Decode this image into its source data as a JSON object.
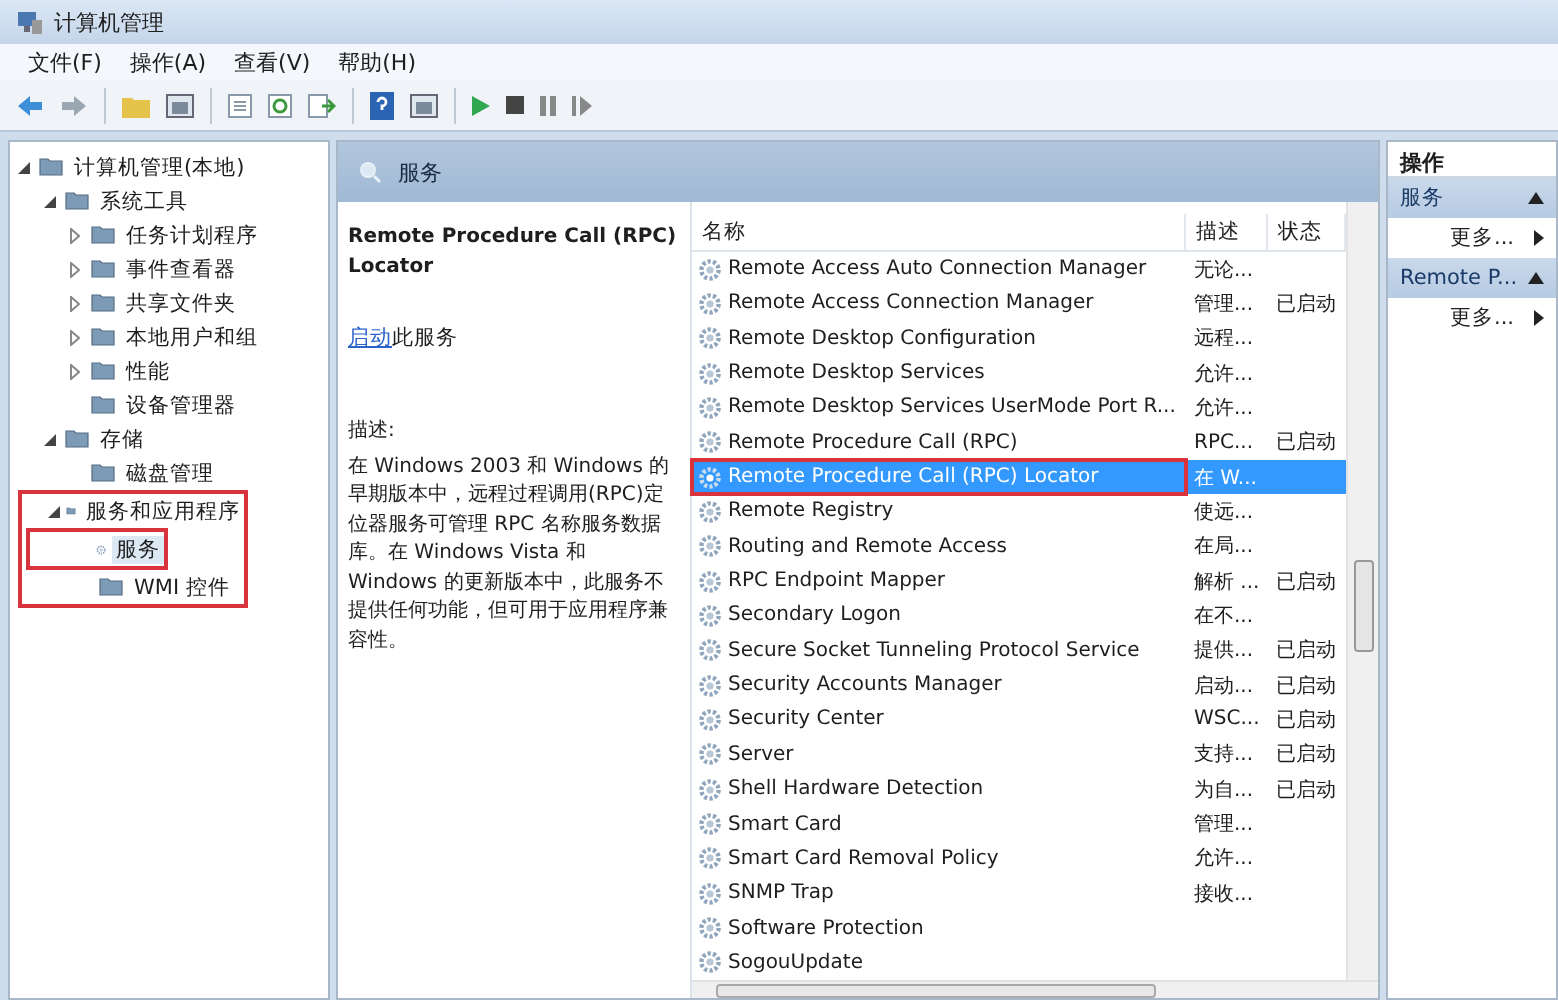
{
  "window": {
    "title": "计算机管理"
  },
  "menu": [
    "文件(F)",
    "操作(A)",
    "查看(V)",
    "帮助(H)"
  ],
  "tree": [
    {
      "label": "计算机管理(本地)",
      "expanded": true,
      "selected": false,
      "children": [
        {
          "label": "系统工具",
          "expanded": true,
          "selected": false,
          "children": [
            {
              "label": "任务计划程序",
              "expanded": false,
              "selected": false
            },
            {
              "label": "事件查看器",
              "expanded": false,
              "selected": false
            },
            {
              "label": "共享文件夹",
              "expanded": false,
              "selected": false
            },
            {
              "label": "本地用户和组",
              "expanded": false,
              "selected": false
            },
            {
              "label": "性能",
              "expanded": false,
              "selected": false
            },
            {
              "label": "设备管理器",
              "selected": false
            }
          ]
        },
        {
          "label": "存储",
          "expanded": true,
          "selected": false,
          "children": [
            {
              "label": "磁盘管理",
              "selected": false
            }
          ]
        },
        {
          "label": "服务和应用程序",
          "expanded": true,
          "selected": false,
          "highlighted": true,
          "children": [
            {
              "label": "服务",
              "selected": true,
              "highlighted": true
            },
            {
              "label": "WMI 控件",
              "selected": false
            }
          ]
        }
      ]
    }
  ],
  "panel_title": "服务",
  "detail": {
    "title": "Remote Procedure Call (RPC) Locator",
    "link": "启动",
    "link_suffix": "此服务",
    "desc_label": "描述:",
    "description": "在 Windows 2003 和 Windows 的早期版本中，远程过程调用(RPC)定位器服务可管理 RPC 名称服务数据库。在 Windows Vista 和 Windows 的更新版本中，此服务不提供任何功能，但可用于应用程序兼容性。"
  },
  "table": {
    "columns": [
      "名称",
      "描述",
      "状态"
    ],
    "rows": [
      {
        "name": "Remote Access Auto Connection Manager",
        "desc": "无论...",
        "status": "",
        "selected": false
      },
      {
        "name": "Remote Access Connection Manager",
        "desc": "管理...",
        "status": "已启动",
        "selected": false
      },
      {
        "name": "Remote Desktop Configuration",
        "desc": "远程...",
        "status": "",
        "selected": false
      },
      {
        "name": "Remote Desktop Services",
        "desc": "允许...",
        "status": "",
        "selected": false
      },
      {
        "name": "Remote Desktop Services UserMode Port R...",
        "desc": "允许...",
        "status": "",
        "selected": false
      },
      {
        "name": "Remote Procedure Call (RPC)",
        "desc": "RPC...",
        "status": "已启动",
        "selected": false
      },
      {
        "name": "Remote Procedure Call (RPC) Locator",
        "desc": "在 W...",
        "status": "",
        "selected": true,
        "highlighted": true
      },
      {
        "name": "Remote Registry",
        "desc": "使远...",
        "status": "",
        "selected": false
      },
      {
        "name": "Routing and Remote Access",
        "desc": "在局...",
        "status": "",
        "selected": false
      },
      {
        "name": "RPC Endpoint Mapper",
        "desc": "解析 ...",
        "status": "已启动",
        "selected": false
      },
      {
        "name": "Secondary Logon",
        "desc": "在不...",
        "status": "",
        "selected": false
      },
      {
        "name": "Secure Socket Tunneling Protocol Service",
        "desc": "提供...",
        "status": "已启动",
        "selected": false
      },
      {
        "name": "Security Accounts Manager",
        "desc": "启动...",
        "status": "已启动",
        "selected": false
      },
      {
        "name": "Security Center",
        "desc": "WSC...",
        "status": "已启动",
        "selected": false
      },
      {
        "name": "Server",
        "desc": "支持...",
        "status": "已启动",
        "selected": false
      },
      {
        "name": "Shell Hardware Detection",
        "desc": "为自...",
        "status": "已启动",
        "selected": false
      },
      {
        "name": "Smart Card",
        "desc": "管理...",
        "status": "",
        "selected": false
      },
      {
        "name": "Smart Card Removal Policy",
        "desc": "允许...",
        "status": "",
        "selected": false
      },
      {
        "name": "SNMP Trap",
        "desc": "接收...",
        "status": "",
        "selected": false
      },
      {
        "name": "Software Protection",
        "desc": "",
        "status": "",
        "selected": false
      },
      {
        "name": "SogouUpdate",
        "desc": "",
        "status": "",
        "selected": false
      }
    ]
  },
  "actions": {
    "title": "操作",
    "groups": [
      {
        "label": "服务",
        "expanded": true,
        "items": [
          "更多..."
        ]
      },
      {
        "label": "Remote P...",
        "expanded": true,
        "items": [
          "更多..."
        ]
      }
    ]
  }
}
